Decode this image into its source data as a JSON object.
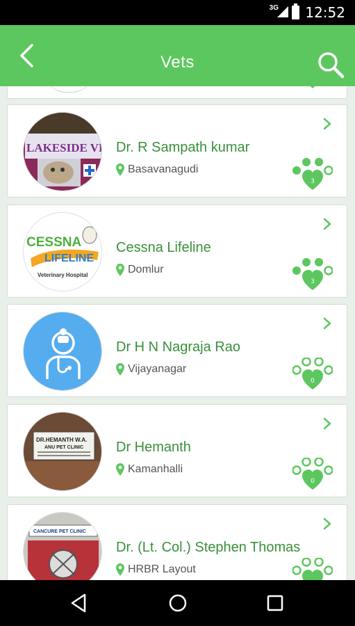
{
  "status_bar": {
    "network": "3G",
    "time": "12:52"
  },
  "app_bar": {
    "title": "Vets"
  },
  "vets": [
    {
      "name": "Dr. R Sampath kumar",
      "location": "Basavanagudi",
      "likes": "3",
      "liked": true,
      "avatar": "lakeside"
    },
    {
      "name": "Cessna Lifeline",
      "location": "Domlur",
      "likes": "3",
      "liked": true,
      "avatar": "cessna"
    },
    {
      "name": "Dr H N Nagraja Rao",
      "location": "Vijayanagar",
      "likes": "0",
      "liked": false,
      "avatar": "doctor"
    },
    {
      "name": "Dr Hemanth",
      "location": "Kamanhalli",
      "likes": "0",
      "liked": false,
      "avatar": "hemanth"
    },
    {
      "name": "Dr. (Lt. Col.) Stephen Thomas",
      "location": "HRBR Layout",
      "likes": "",
      "liked": false,
      "avatar": "cancure"
    }
  ],
  "avatars": {
    "lakeside": "LAKESIDE VE",
    "cessna_line1": "CESSNA",
    "cessna_line2": "LIFELINE",
    "cessna_sub": "Veterinary Hospital",
    "hemanth_line1": "DR.HEMANTH W.A.",
    "hemanth_line2": "ANU PET CLINIC",
    "cancure": "CANCURE PET CLINIC"
  },
  "colors": {
    "brand": "#5dc75f",
    "name_text": "#3a8f3c",
    "background": "#e9efe9"
  }
}
